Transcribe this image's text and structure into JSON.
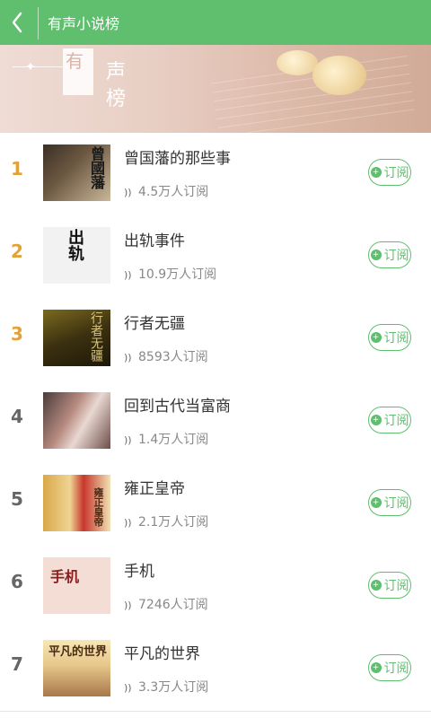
{
  "header": {
    "title": "有声小说榜",
    "back_icon": "chevron-left-icon"
  },
  "banner": {
    "big_char": "有",
    "chars": [
      "声",
      "榜"
    ]
  },
  "colors": {
    "accent": "#5fbf6e",
    "rank_top": "#e2a23a",
    "rank_other": "#666666"
  },
  "list": {
    "subscribe_label": "订阅",
    "items": [
      {
        "rank": "1",
        "title": "曾国藩的那些事",
        "subs": "4.5万人订阅",
        "cover_text": "曾國藩",
        "cover_style": "c1"
      },
      {
        "rank": "2",
        "title": "出轨事件",
        "subs": "10.9万人订阅",
        "cover_text": "出轨",
        "cover_style": "c2"
      },
      {
        "rank": "3",
        "title": "行者无疆",
        "subs": "8593人订阅",
        "cover_text": "行者无疆",
        "cover_style": "c3"
      },
      {
        "rank": "4",
        "title": "回到古代当富商",
        "subs": "1.4万人订阅",
        "cover_text": "",
        "cover_style": "c4"
      },
      {
        "rank": "5",
        "title": "雍正皇帝",
        "subs": "2.1万人订阅",
        "cover_text": "雍正皇帝",
        "cover_style": "c5"
      },
      {
        "rank": "6",
        "title": "手机",
        "subs": "7246人订阅",
        "cover_text": "手机",
        "cover_style": "c6"
      },
      {
        "rank": "7",
        "title": "平凡的世界",
        "subs": "3.3万人订阅",
        "cover_text": "平凡的世界",
        "cover_style": "c7"
      }
    ]
  }
}
